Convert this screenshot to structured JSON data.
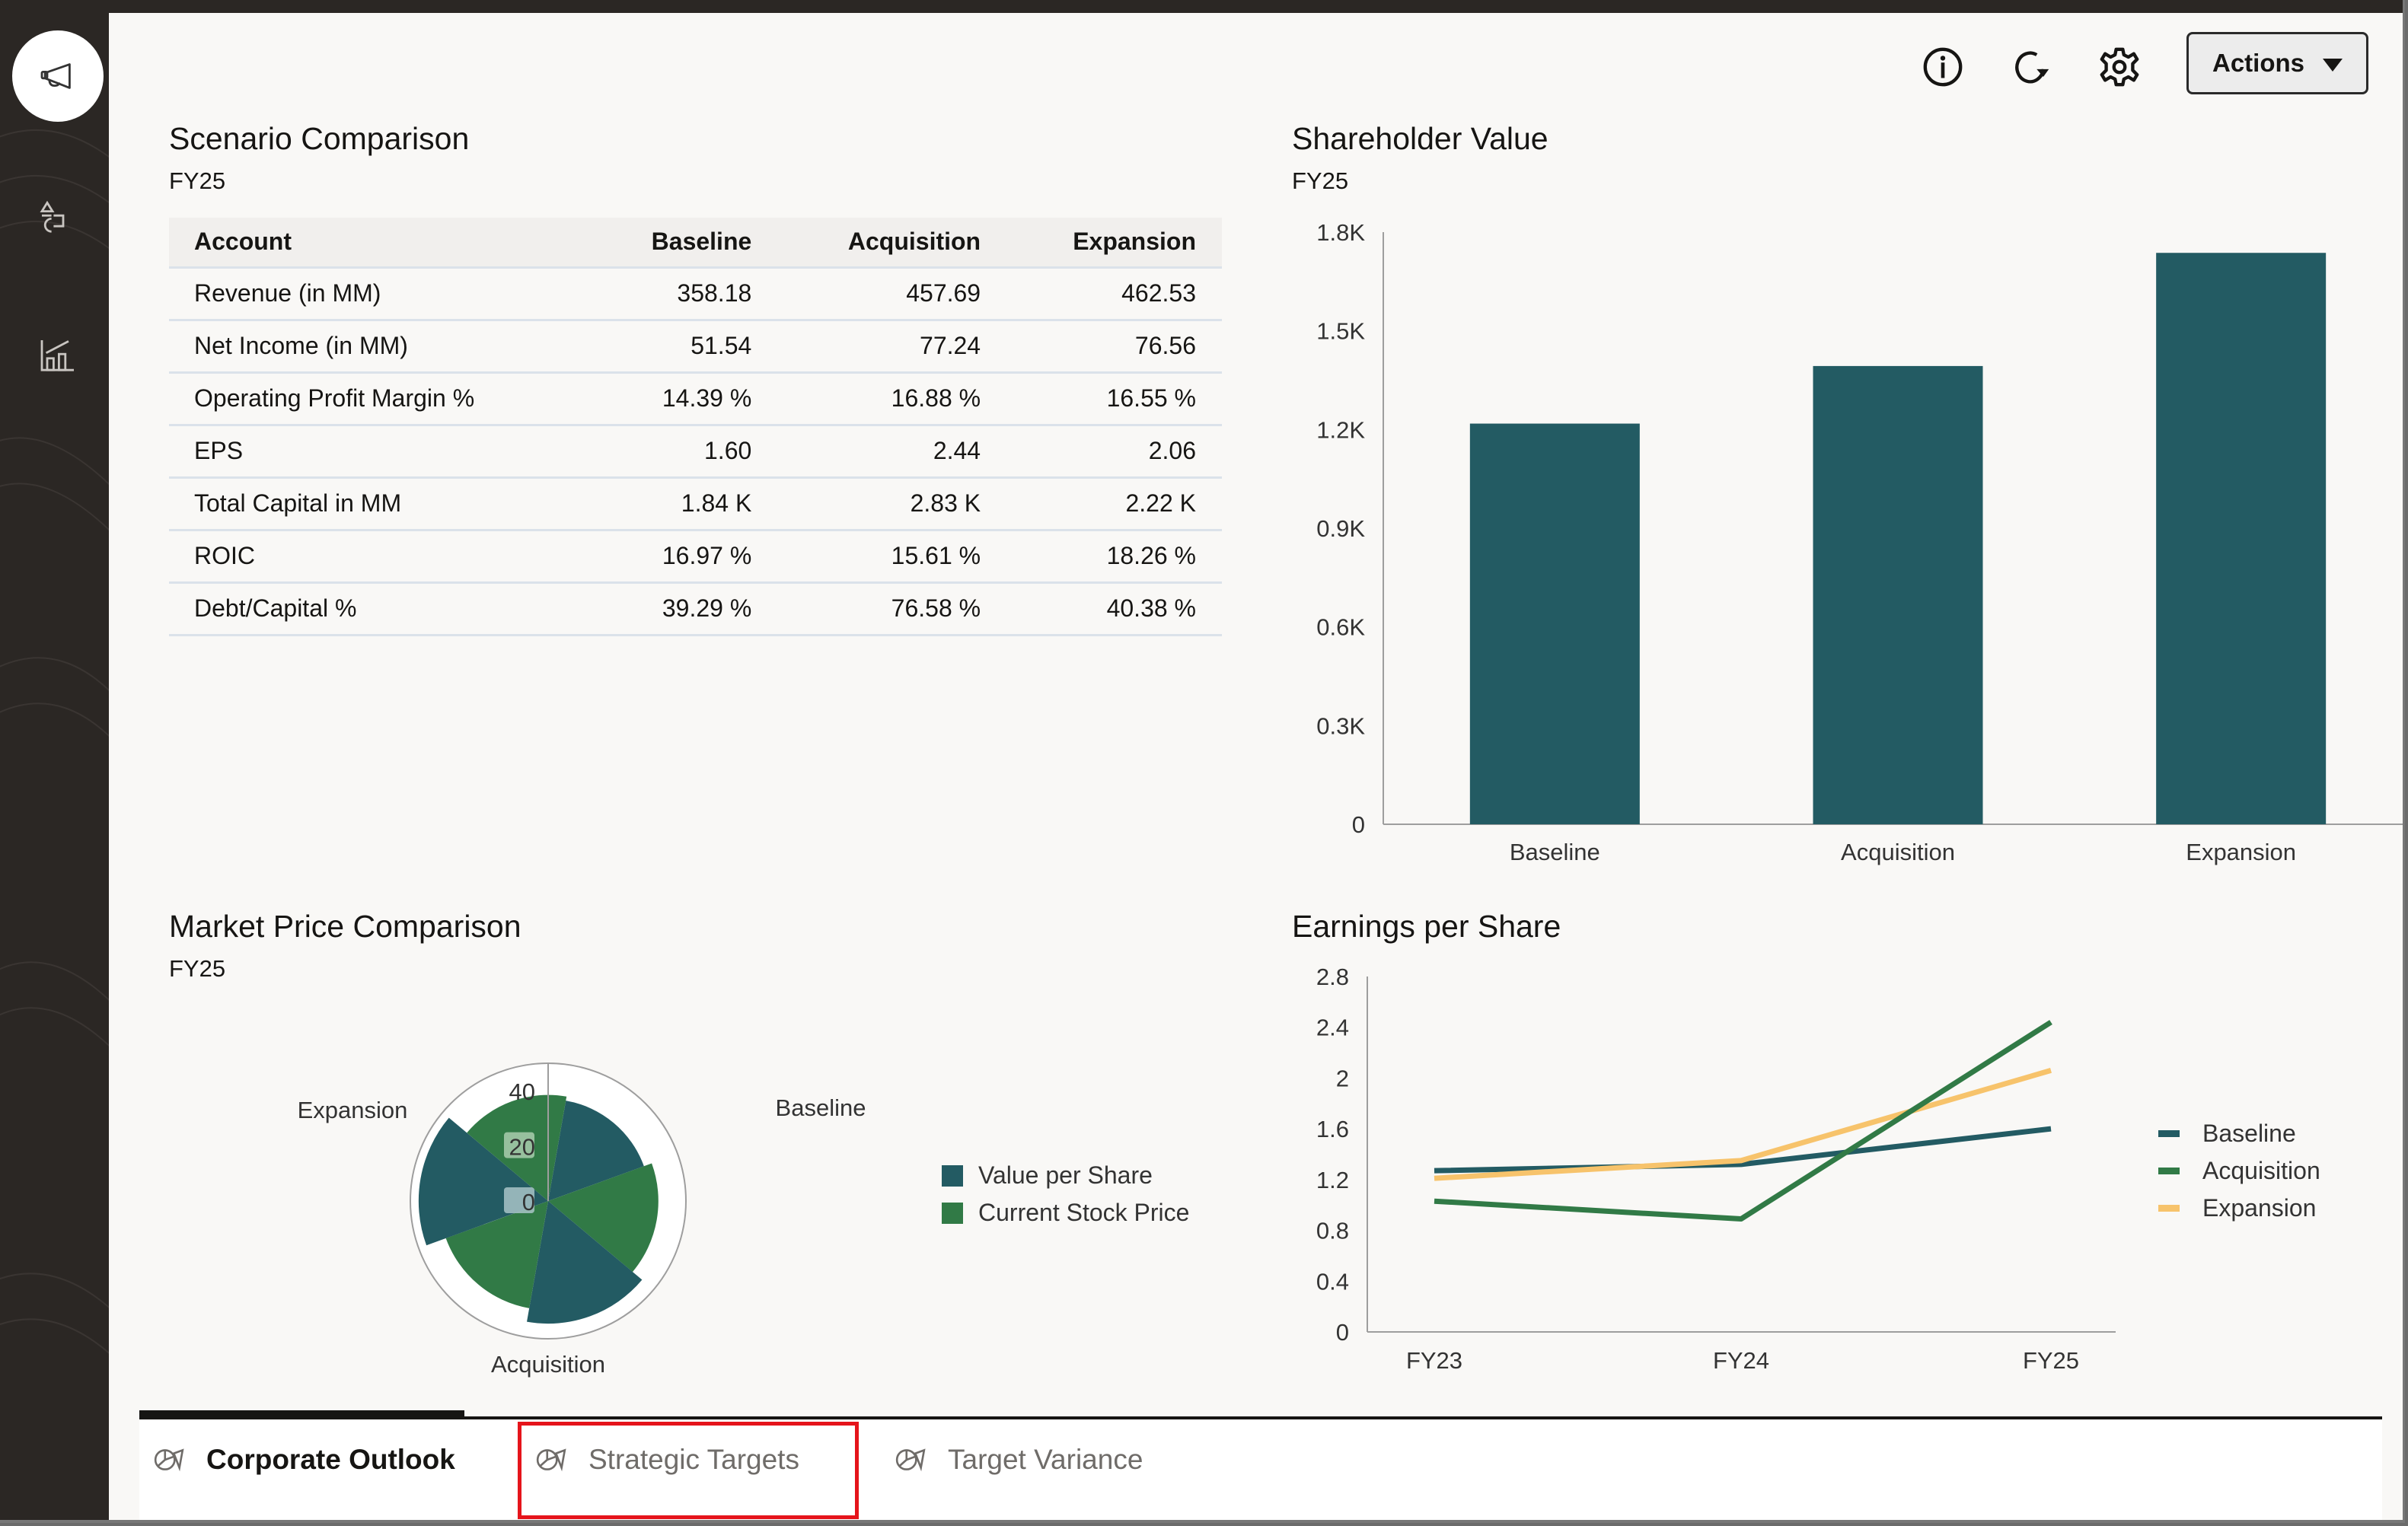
{
  "sidebar": {
    "items": [
      {
        "id": "announcements",
        "icon": "megaphone-icon",
        "active": true
      },
      {
        "id": "shapes",
        "icon": "shapes-icon",
        "active": false
      },
      {
        "id": "analytics",
        "icon": "bar-chart-trend-icon",
        "active": false
      }
    ]
  },
  "toolbar": {
    "info_icon": "info-icon",
    "refresh_icon": "refresh-icon",
    "settings_icon": "gear-icon",
    "actions_label": "Actions"
  },
  "scenario_comparison": {
    "title": "Scenario Comparison",
    "subtitle": "FY25",
    "columns": [
      "Account",
      "Baseline",
      "Acquisition",
      "Expansion"
    ],
    "rows": [
      [
        "Revenue (in MM)",
        "358.18",
        "457.69",
        "462.53"
      ],
      [
        "Net Income (in MM)",
        "51.54",
        "77.24",
        "76.56"
      ],
      [
        "Operating Profit Margin %",
        "14.39 %",
        "16.88 %",
        "16.55 %"
      ],
      [
        "EPS",
        "1.60",
        "2.44",
        "2.06"
      ],
      [
        "Total Capital in MM",
        "1.84 K",
        "2.83 K",
        "2.22 K"
      ],
      [
        "ROIC",
        "16.97 %",
        "15.61 %",
        "18.26 %"
      ],
      [
        "Debt/Capital %",
        "39.29 %",
        "76.58 %",
        "40.38 %"
      ]
    ]
  },
  "shareholder_value": {
    "title": "Shareholder Value",
    "subtitle": "FY25"
  },
  "market_price": {
    "title": "Market Price Comparison",
    "subtitle": "FY25"
  },
  "eps": {
    "title": "Earnings per Share"
  },
  "colors": {
    "teal": "#235b63",
    "green": "#317a46",
    "gold": "#f7c36b"
  },
  "chart_data": [
    {
      "id": "shareholder-value",
      "type": "bar",
      "title": "Shareholder Value",
      "subtitle": "FY25",
      "categories": [
        "Baseline",
        "Acquisition",
        "Expansion"
      ],
      "values": [
        1218,
        1393,
        1737
      ],
      "yticks": [
        "0",
        "0.3K",
        "0.6K",
        "0.9K",
        "1.2K",
        "1.5K",
        "1.8K"
      ],
      "ylim": [
        0,
        1800
      ],
      "xlabel": "",
      "ylabel": "",
      "grid": false,
      "legend": "none"
    },
    {
      "id": "market-price-comparison",
      "type": "polar-bar",
      "title": "Market Price Comparison",
      "subtitle": "FY25",
      "categories": [
        "Baseline",
        "Acquisition",
        "Expansion"
      ],
      "series": [
        {
          "name": "Value per Share",
          "values": [
            37,
            44.5,
            47
          ]
        },
        {
          "name": "Current Stock Price",
          "values": [
            40,
            39.5,
            38.5
          ]
        }
      ],
      "rticks": [
        "0",
        "20",
        "40"
      ],
      "rlim": [
        0,
        50
      ],
      "legend": "right"
    },
    {
      "id": "earnings-per-share",
      "type": "line",
      "title": "Earnings per Share",
      "categories": [
        "FY23",
        "FY24",
        "FY25"
      ],
      "series": [
        {
          "name": "Baseline",
          "values": [
            1.27,
            1.32,
            1.6
          ]
        },
        {
          "name": "Acquisition",
          "values": [
            1.03,
            0.89,
            2.44
          ]
        },
        {
          "name": "Expansion",
          "values": [
            1.21,
            1.35,
            2.06
          ]
        }
      ],
      "yticks": [
        "0",
        "0.4",
        "0.8",
        "1.2",
        "1.6",
        "2",
        "2.4",
        "2.8"
      ],
      "ylim": [
        0,
        2.8
      ],
      "grid": false,
      "legend": "right"
    }
  ],
  "tabs": [
    {
      "label": "Corporate Outlook",
      "active": true,
      "icon": "dashboard-icon"
    },
    {
      "label": "Strategic Targets",
      "active": false,
      "icon": "dashboard-icon",
      "highlighted": true
    },
    {
      "label": "Target Variance",
      "active": false,
      "icon": "dashboard-icon"
    }
  ]
}
